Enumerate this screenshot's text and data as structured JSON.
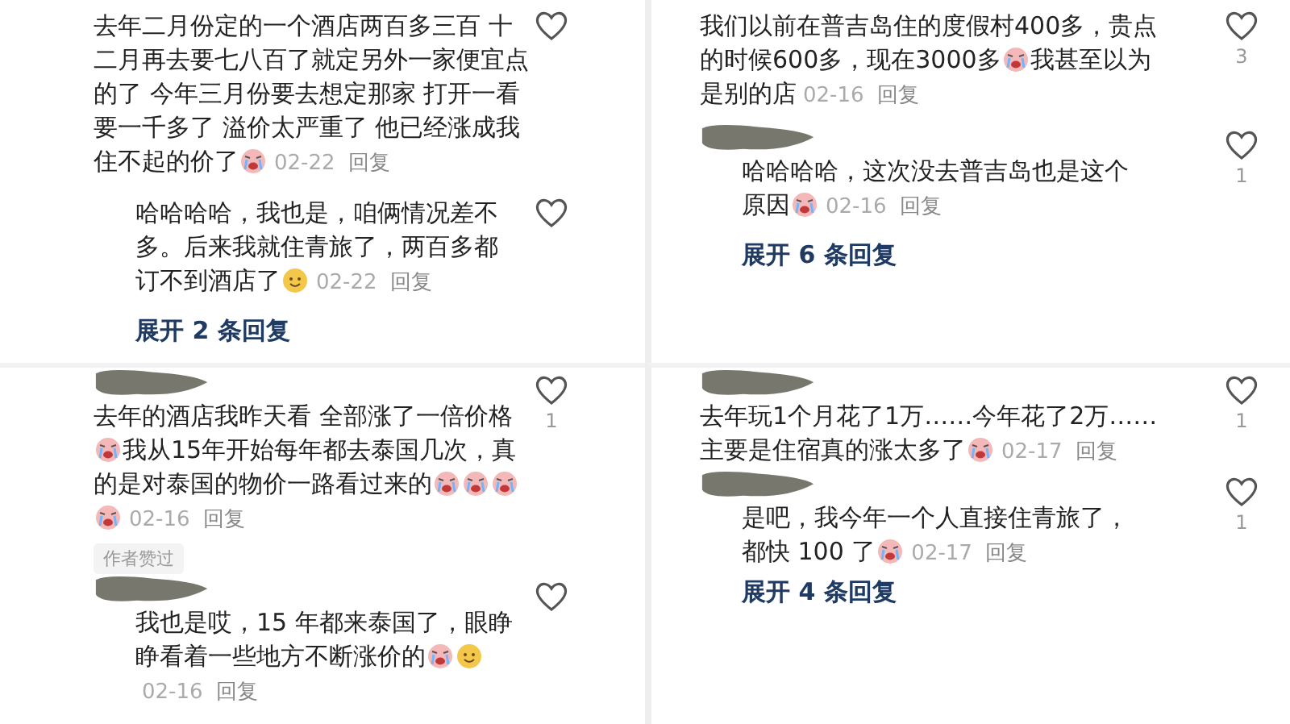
{
  "panels": [
    {
      "comments": [
        {
          "kind": "comment",
          "masked": false,
          "segments": [
            {
              "kind": "text",
              "text": "去年二月份定的一个酒店两百多三百 十二月再去要七八百了就定另外一家便宜点的了 今年三月份要去想定那家 打开一看要一千多了 溢价太严重了 他已经涨成我住不起的价了"
            },
            {
              "kind": "emoji"
            }
          ],
          "date": "02-22",
          "reply": "回复"
        },
        {
          "kind": "reply",
          "masked": false,
          "segments": [
            {
              "kind": "text",
              "text": "哈哈哈哈，我也是，咱俩情况差不多。后来我就住青旅了，两百多都订不到酒店了"
            },
            {
              "kind": "smile"
            }
          ],
          "date": "02-22",
          "reply": "回复"
        }
      ],
      "expand": "展开 2 条回复"
    },
    {
      "comments": [
        {
          "kind": "comment",
          "masked": true,
          "likes": "1",
          "segments": [
            {
              "kind": "text",
              "text": "去年的酒店我昨天看 全部涨了一倍价格"
            },
            {
              "kind": "emoji"
            },
            {
              "kind": "text",
              "text": "我从15年开始每年都去泰国几次，真的是对泰国的物价一路看过来的"
            },
            {
              "kind": "emoji"
            },
            {
              "kind": "emoji"
            },
            {
              "kind": "emoji"
            },
            {
              "kind": "emoji"
            }
          ],
          "date": "02-16",
          "reply": "回复",
          "badge": "作者赞过"
        },
        {
          "kind": "reply",
          "masked": true,
          "segments": [
            {
              "kind": "text",
              "text": "我也是哎，15 年都来泰国了，眼睁睁看着一些地方不断涨价的"
            },
            {
              "kind": "emoji"
            },
            {
              "kind": "smile"
            }
          ],
          "date": "02-16",
          "reply": "回复"
        }
      ]
    },
    {
      "comments": [
        {
          "kind": "comment",
          "masked": false,
          "likes": "3",
          "segments": [
            {
              "kind": "text",
              "text": "我们以前在普吉岛住的度假村400多，贵点的时候600多，现在3000多"
            },
            {
              "kind": "emoji"
            },
            {
              "kind": "text",
              "text": "我甚至以为是别的店"
            }
          ],
          "date": "02-16",
          "reply": "回复"
        },
        {
          "kind": "reply",
          "masked": true,
          "likes": "1",
          "segments": [
            {
              "kind": "text",
              "text": "哈哈哈哈，这次没去普吉岛也是这个原因"
            },
            {
              "kind": "emoji"
            }
          ],
          "date": "02-16",
          "reply": "回复"
        }
      ],
      "expand": "展开 6 条回复"
    },
    {
      "comments": [
        {
          "kind": "comment",
          "masked": true,
          "likes": "1",
          "segments": [
            {
              "kind": "text",
              "text": "去年玩1个月花了1万……今年花了2万……主要是住宿真的涨太多了"
            },
            {
              "kind": "emoji"
            }
          ],
          "date": "02-17",
          "reply": "回复"
        },
        {
          "kind": "reply",
          "masked": true,
          "likes": "1",
          "segments": [
            {
              "kind": "text",
              "text": "是吧，我今年一个人直接住青旅了，都快 100 了"
            },
            {
              "kind": "emoji"
            }
          ],
          "date": "02-17",
          "reply": "回复"
        }
      ],
      "expand": "展开 4 条回复"
    }
  ]
}
